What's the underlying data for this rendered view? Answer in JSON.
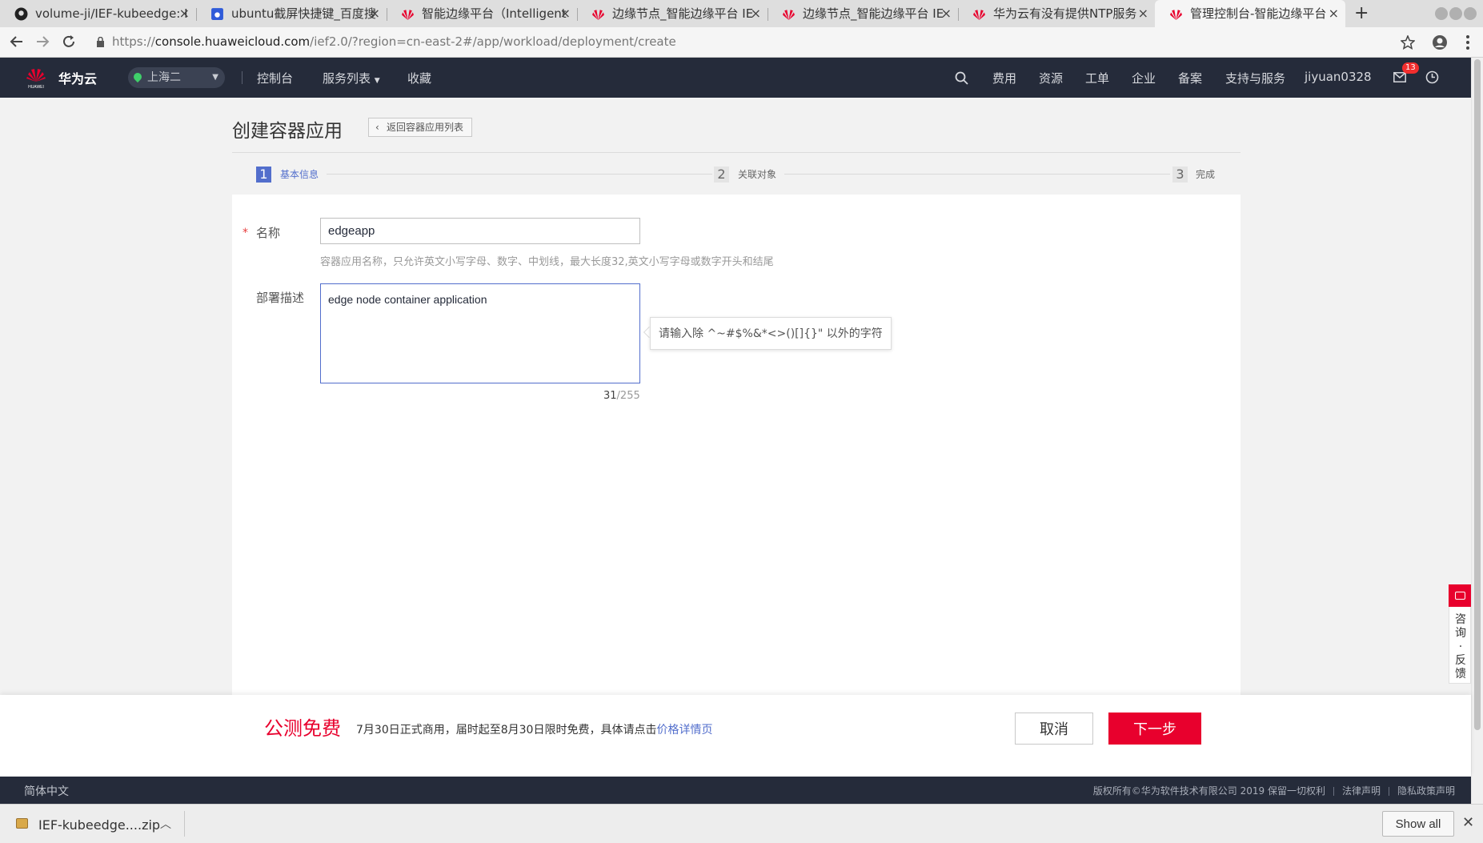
{
  "browser": {
    "tabs": [
      {
        "title": "volume-ji/IEF-kubeedge: I",
        "icon": "github-icon"
      },
      {
        "title": "ubuntu截屏快捷键_百度搜",
        "icon": "baidu-icon"
      },
      {
        "title": "智能边缘平台（Intelligent",
        "icon": "huawei-icon"
      },
      {
        "title": "边缘节点_智能边缘平台 IE",
        "icon": "huawei-icon"
      },
      {
        "title": "边缘节点_智能边缘平台 IE",
        "icon": "huawei-icon"
      },
      {
        "title": "华为云有没有提供NTP服务",
        "icon": "huawei-icon"
      },
      {
        "title": "管理控制台-智能边缘平台",
        "icon": "huawei-icon"
      }
    ],
    "tab_close": "×",
    "new_tab": "+",
    "url_scheme": "https://",
    "url_host": "console.huaweicloud.com",
    "url_path": "/ief2.0/?region=cn-east-2#/app/workload/deployment/create"
  },
  "topnav": {
    "brand": "华为云",
    "logo_text": "HUAWEI",
    "region": "上海二",
    "links": [
      "控制台",
      "服务列表",
      "收藏"
    ],
    "right_links": [
      "费用",
      "资源",
      "工单",
      "企业",
      "备案",
      "支持与服务"
    ],
    "username": "jiyuan0328",
    "message_count": "13"
  },
  "page": {
    "title": "创建容器应用",
    "back_label": "返回容器应用列表",
    "steps": [
      {
        "num": "1",
        "label": "基本信息"
      },
      {
        "num": "2",
        "label": "关联对象"
      },
      {
        "num": "3",
        "label": "完成"
      }
    ],
    "form": {
      "required_mark": "*",
      "name_label": "名称",
      "name_value": "edgeapp",
      "name_hint": "容器应用名称，只允许英文小写字母、数字、中划线，最大长度32,英文小写字母或数字开头和结尾",
      "desc_label": "部署描述",
      "desc_value": "edge node container application",
      "count_current": "31",
      "count_max": "/255",
      "tooltip": "请输入除 ^~#$%&*<>()[]{}\" 以外的字符"
    }
  },
  "side_widget": {
    "text": "咨询·反馈"
  },
  "actionbar": {
    "promo_title": "公测免费",
    "promo_text": "7月30日正式商用，届时起至8月30日限时免费，具体请点击",
    "promo_link": "价格详情页",
    "cancel": "取消",
    "next": "下一步"
  },
  "footer": {
    "lang": "简体中文",
    "copyright": "版权所有©华为软件技术有限公司 2019 保留一切权利",
    "legal": "法律声明",
    "privacy": "隐私政策声明"
  },
  "downloads": {
    "file": "IEF-kubeedge....zip",
    "show_all": "Show all"
  }
}
